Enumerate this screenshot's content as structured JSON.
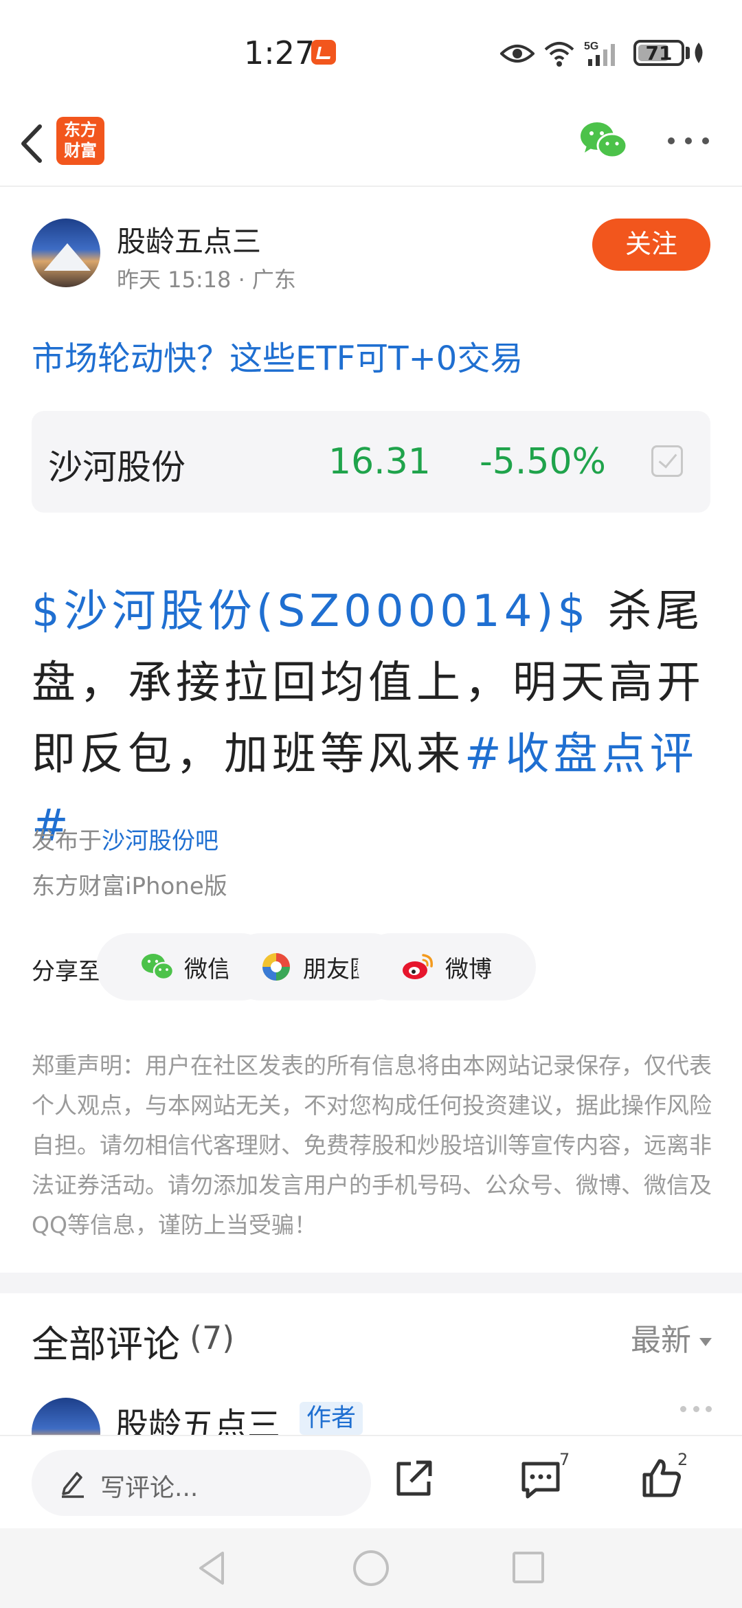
{
  "status_bar": {
    "time": "1:27",
    "network": "5G",
    "battery": "71",
    "battery_level": 0.71
  },
  "header": {
    "brand_logo_text": "东方\n财富",
    "icons": [
      "back-arrow-icon",
      "brand-logo",
      "wechat-icon",
      "more-icon"
    ]
  },
  "author": {
    "name": "股龄五点三",
    "time": "昨天 15:18",
    "location": "广东",
    "separator": " · ",
    "follow_label": "关注"
  },
  "related_title": "市场轮动快？这些ETF可T+0交易",
  "stock": {
    "name": "沙河股份",
    "price": "16.31",
    "change": "-5.50%",
    "color": "#1fa34b"
  },
  "post": {
    "stock_tag": "$沙河股份(SZ000014)$",
    "text": " 杀尾盘，承接拉回均值上，明天高开即反包，加班等风来",
    "topic": "#收盘点评#"
  },
  "publish": {
    "prefix": "发布于",
    "bar_name": "沙河股份吧",
    "client": "东方财富iPhone版"
  },
  "share": {
    "label": "分享至:",
    "targets": [
      "微信",
      "朋友圈",
      "微博"
    ]
  },
  "disclaimer": "郑重声明：用户在社区发表的所有信息将由本网站记录保存，仅代表个人观点，与本网站无关，不对您构成任何投资建议，据此操作风险自担。请勿相信代客理财、免费荐股和炒股培训等宣传内容，远离非法证券活动。请勿添加发言用户的手机号码、公众号、微博、微信及QQ等信息，谨防上当受骗！",
  "comments": {
    "title": "全部评论",
    "count": "(7)",
    "sort": "最新",
    "first": {
      "name": "股龄五点三",
      "badge": "作者"
    }
  },
  "bottom_bar": {
    "input_placeholder": "写评论...",
    "comment_count": "7",
    "like_count": "2"
  },
  "colors": {
    "accent": "#f2561d",
    "link": "#1f6fd1",
    "down": "#1fa34b"
  }
}
